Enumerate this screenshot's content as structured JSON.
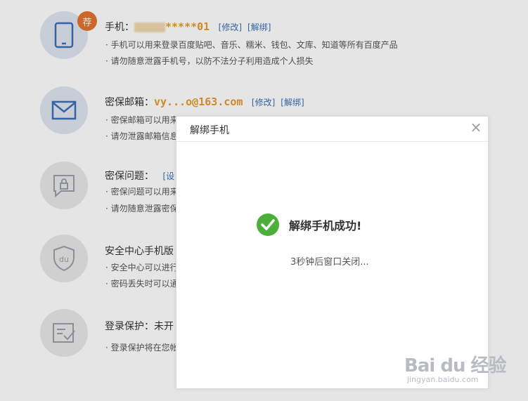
{
  "items": [
    {
      "label": "手机：",
      "value": "*****01",
      "links": [
        "[修改]",
        "[解绑]"
      ],
      "badge": "荐",
      "desc": [
        "· 手机可以用来登录百度贴吧、音乐、糯米、钱包、文库、知道等所有百度产品",
        "· 请勿随意泄露手机号，以防不法分子利用造成个人损失"
      ]
    },
    {
      "label": "密保邮箱：",
      "value": "vy...o@163.com",
      "links": [
        "[修改]",
        "[解绑]"
      ],
      "desc": [
        "· 密保邮箱可以用来",
        "· 请勿泄露邮箱信息"
      ]
    },
    {
      "label": "密保问题：",
      "links": [
        "[设"
      ],
      "desc": [
        "· 密保问题可以用来",
        "· 请勿随意泄露密保"
      ]
    },
    {
      "label": "安全中心手机版",
      "desc": [
        "· 安全中心可以进行",
        "· 密码丢失时可以通"
      ]
    },
    {
      "label": "登录保护：未开",
      "desc": [
        "· 登录保护将在您帐"
      ]
    }
  ],
  "dialog": {
    "title": "解绑手机",
    "close": "×",
    "success": "解绑手机成功!",
    "countdown": "3秒钟后窗口关闭..."
  },
  "watermark": {
    "main": "Bai du 经验",
    "sub": "jingyan.baidu.com"
  },
  "icons": [
    "phone-icon",
    "mail-icon",
    "question-icon",
    "shield-du-icon",
    "login-protect-icon",
    "check-icon",
    "close-icon"
  ],
  "colors": {
    "accent_orange": "#e69a2b",
    "link_blue": "#3b6fb6",
    "success_green": "#4caf3a",
    "badge_orange": "#e3742e"
  }
}
